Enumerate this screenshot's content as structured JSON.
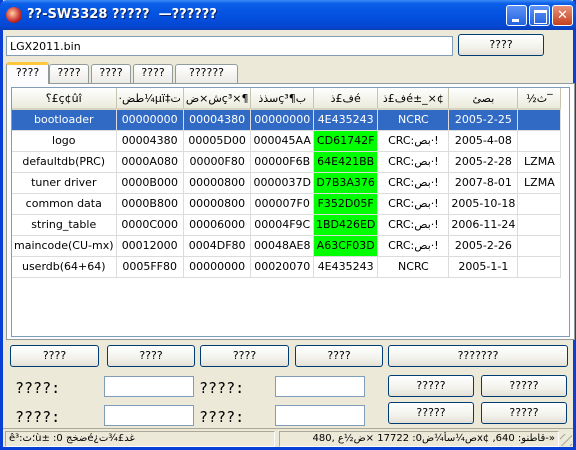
{
  "window": {
    "title": "??-SW3328 ?????  —??????"
  },
  "file": {
    "path": "LGX2011.bin",
    "browse_label": "????"
  },
  "tabs": [
    "????",
    "????",
    "????",
    "????",
    "??????"
  ],
  "table": {
    "headers": [
      "؟£ç¢ûî",
      "·طض¼µï‡ت",
      "ش×ضç³×¶",
      "سذذç³¶ب",
      "ف£ذé",
      "ف£ذé±_×¢",
      "بصئ",
      "½ث‾"
    ],
    "selected_row": 0,
    "rows": [
      {
        "cells": [
          "bootloader",
          "00000000",
          "00004380",
          "00000000",
          "4E435243",
          "NCRC",
          "2005-2-25",
          ""
        ],
        "green": false
      },
      {
        "cells": [
          "logo",
          "00004380",
          "00005D00",
          "000045AA",
          "CD61742F",
          "CRC:بص·!",
          "2005-4-08",
          ""
        ],
        "green": true
      },
      {
        "cells": [
          "defaultdb(PRC)",
          "0000A080",
          "00000F80",
          "00000F6B",
          "64E421BB",
          "CRC:بص·!",
          "2005-2-28",
          "LZMA"
        ],
        "green": true
      },
      {
        "cells": [
          "tuner driver",
          "0000B000",
          "00000800",
          "0000037D",
          "D7B3A376",
          "CRC:بص·!",
          "2007-8-01",
          "LZMA"
        ],
        "green": true
      },
      {
        "cells": [
          "common data",
          "0000B800",
          "00000800",
          "000007F0",
          "F352D05F",
          "CRC:بص·!",
          "2005-10-18",
          ""
        ],
        "green": true
      },
      {
        "cells": [
          "string_table",
          "0000C000",
          "00006000",
          "00004F9C",
          "1BD426ED",
          "CRC:بص·!",
          "2006-11-24",
          ""
        ],
        "green": true
      },
      {
        "cells": [
          "maincode(CU-mx)",
          "00012000",
          "0004DF80",
          "00048AE8",
          "A63CF03D",
          "CRC:بص·!",
          "2005-2-26",
          ""
        ],
        "green": true
      },
      {
        "cells": [
          "userdb(64+64)",
          "0005FF80",
          "00000000",
          "00020070",
          "4E435243",
          "NCRC",
          "2005-1-1",
          ""
        ],
        "green": false
      }
    ]
  },
  "buttons_row": [
    "????",
    "????",
    "????",
    "????",
    "???????"
  ],
  "fields": {
    "label1": "????:",
    "label2": "????:",
    "label3": "????:",
    "label4": "????:"
  },
  "right_buttons": [
    "?????",
    "?????",
    "?????",
    "?????"
  ],
  "status": {
    "left": "ê³:؛ثù± :0 ضخجé¿غد£¾ت",
    "right": "ص¼سأ¼ض0: 17722 ×ض½ع ,480x¢ ,قاطنو: 640-»"
  },
  "colors": {
    "selected": "#316AC5",
    "crc_ok": "#00FF00"
  }
}
